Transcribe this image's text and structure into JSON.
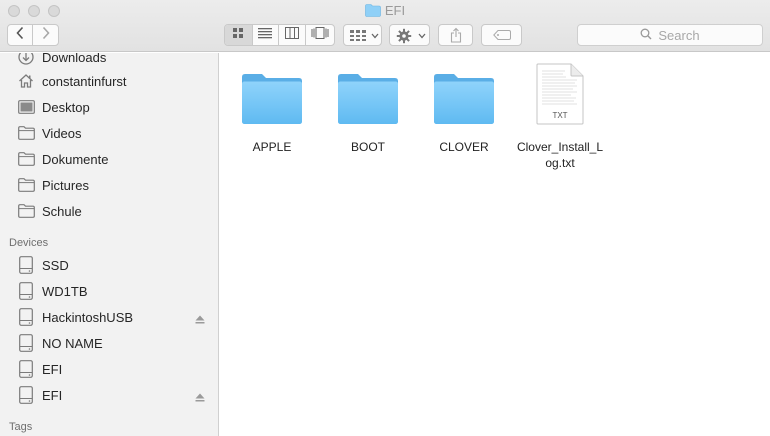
{
  "window": {
    "title": "EFI",
    "folder_icon": "folder-icon"
  },
  "toolbar": {
    "back_icon": "chevron-left-icon",
    "forward_icon": "chevron-right-icon",
    "view_modes": [
      "icon-view-icon",
      "list-view-icon",
      "column-view-icon",
      "cover-flow-icon"
    ],
    "active_view": "icon-view-icon",
    "arrange_icon": "arrange-grid-icon",
    "action_icon": "gear-icon",
    "share_icon": "share-icon",
    "tag_icon": "tag-icon",
    "search_placeholder": "Search"
  },
  "sidebar": {
    "favorites": [
      {
        "label": "Downloads",
        "icon": "downloads-icon"
      },
      {
        "label": "constantinfurst",
        "icon": "home-icon"
      },
      {
        "label": "Desktop",
        "icon": "desktop-icon"
      },
      {
        "label": "Videos",
        "icon": "folder-icon"
      },
      {
        "label": "Dokumente",
        "icon": "folder-icon"
      },
      {
        "label": "Pictures",
        "icon": "folder-icon"
      },
      {
        "label": "Schule",
        "icon": "folder-icon"
      }
    ],
    "devices_header": "Devices",
    "devices": [
      {
        "label": "SSD",
        "icon": "drive-icon",
        "eject": false
      },
      {
        "label": "WD1TB",
        "icon": "drive-icon",
        "eject": false
      },
      {
        "label": "HackintoshUSB",
        "icon": "drive-icon",
        "eject": true
      },
      {
        "label": "NO NAME",
        "icon": "drive-icon",
        "eject": false
      },
      {
        "label": "EFI",
        "icon": "drive-icon",
        "eject": false
      },
      {
        "label": "EFI",
        "icon": "drive-icon",
        "eject": true
      }
    ],
    "tags_header": "Tags"
  },
  "files": [
    {
      "name": "APPLE",
      "kind": "folder"
    },
    {
      "name": "BOOT",
      "kind": "folder"
    },
    {
      "name": "CLOVER",
      "kind": "folder"
    },
    {
      "name": "Clover_Install_Log.txt",
      "name_lines": [
        "Clover_Install_L",
        "og.txt"
      ],
      "kind": "document",
      "badge": "TXT"
    }
  ],
  "colors": {
    "folder_top": "#8fd3fb",
    "folder_bottom": "#5fbaf1",
    "sidebar_bg": "#f2f2f2",
    "toolbar_bg": "#e6e6e6"
  }
}
